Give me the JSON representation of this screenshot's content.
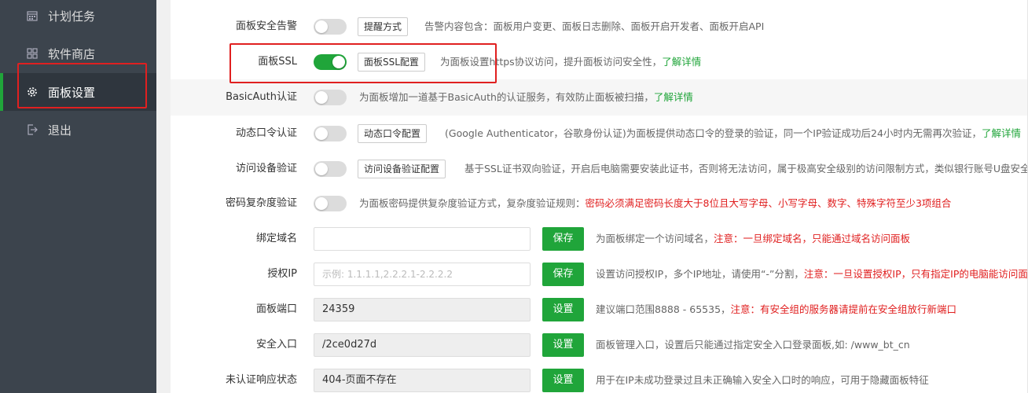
{
  "sidebar": {
    "items": [
      {
        "label": "计划任务",
        "icon": "calendar-icon"
      },
      {
        "label": "软件商店",
        "icon": "grid-icon"
      },
      {
        "label": "面板设置",
        "icon": "gear-icon"
      },
      {
        "label": "退出",
        "icon": "logout-icon"
      }
    ],
    "active_index": 2
  },
  "settings": {
    "alarm": {
      "label": "面板安全告警",
      "enabled": false,
      "button": "提醒方式",
      "desc": "告警内容包含：面板用户变更、面板日志删除、面板开启开发者、面板开启API"
    },
    "ssl": {
      "label": "面板SSL",
      "enabled": true,
      "button": "面板SSL配置",
      "desc": "为面板设置https协议访问，提升面板访问安全性，",
      "link": "了解详情"
    },
    "basicauth": {
      "label": "BasicAuth认证",
      "enabled": false,
      "desc": "为面板增加一道基于BasicAuth的认证服务，有效防止面板被扫描，",
      "link": "了解详情"
    },
    "dynpass": {
      "label": "动态口令认证",
      "enabled": false,
      "button": "动态口令配置",
      "desc": "(Google Authenticator，谷歌身份认证)为面板提供动态口令的登录的验证，同一个IP验证成功后24小时内无需再次验证，",
      "link": "了解详情"
    },
    "device": {
      "label": "访问设备验证",
      "enabled": false,
      "button": "访问设备验证配置",
      "desc": "基于SSL证书双向验证，开启后电脑需要安装此证书，否则将无法访问，属于极高安全级别的访问限制方式，类似银行账号U盘安全"
    },
    "complexity": {
      "label": "密码复杂度验证",
      "enabled": false,
      "desc": "为面板密码提供复杂度验证方式，复杂度验证规则：",
      "desc_red": "密码必须满足密码长度大于8位且大写字母、小写字母、数字、特殊字符至少3项组合"
    },
    "domain": {
      "label": "绑定域名",
      "value": "",
      "button": "保存",
      "desc": "为面板绑定一个访问域名，",
      "desc_red": "注意：一旦绑定域名，只能通过域名访问面板"
    },
    "authip": {
      "label": "授权IP",
      "placeholder": "示例: 1.1.1.1,2.2.2.1-2.2.2.2",
      "button": "保存",
      "desc": "设置访问授权IP，多个IP地址，请使用“-”分割，",
      "desc_red": "注意：一旦设置授权IP，只有指定IP的电脑能访问面板"
    },
    "port": {
      "label": "面板端口",
      "value": "24359",
      "button": "设置",
      "desc": "建议端口范围8888 - 65535，",
      "desc_red": "注意：有安全组的服务器请提前在安全组放行新端口"
    },
    "entry": {
      "label": "安全入口",
      "value": "/2ce0d27d",
      "button": "设置",
      "desc": "面板管理入口，设置后只能通过指定安全入口登录面板,如: /www_bt_cn"
    },
    "unauth": {
      "label": "未认证响应状态",
      "value": "404-页面不存在",
      "button": "设置",
      "desc": "用于在IP未成功登录过且未正确输入安全入口时的响应，可用于隐藏面板特征"
    }
  },
  "colors": {
    "accent": "#20a53a",
    "warning": "#e01e1e",
    "sidebar": "#3c444d",
    "highlight_box": "#e02020"
  }
}
